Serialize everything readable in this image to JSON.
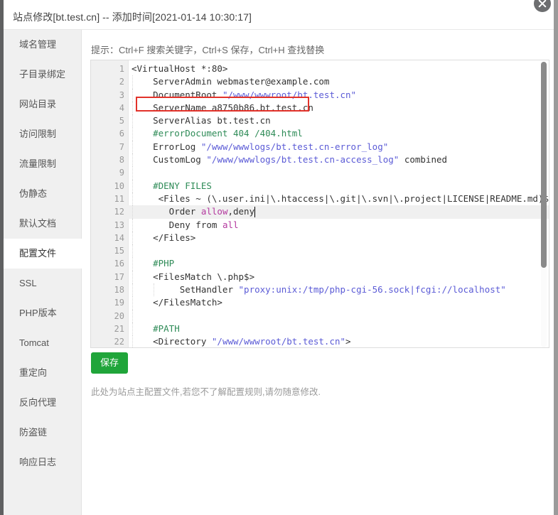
{
  "window": {
    "title": "站点修改[bt.test.cn] -- 添加时间[2021-01-14 10:30:17]",
    "close_label": "×"
  },
  "sidebar": {
    "items": [
      {
        "label": "域名管理",
        "active": false
      },
      {
        "label": "子目录绑定",
        "active": false
      },
      {
        "label": "网站目录",
        "active": false
      },
      {
        "label": "访问限制",
        "active": false
      },
      {
        "label": "流量限制",
        "active": false
      },
      {
        "label": "伪静态",
        "active": false
      },
      {
        "label": "默认文档",
        "active": false
      },
      {
        "label": "配置文件",
        "active": true
      },
      {
        "label": "SSL",
        "active": false
      },
      {
        "label": "PHP版本",
        "active": false
      },
      {
        "label": "Tomcat",
        "active": false
      },
      {
        "label": "重定向",
        "active": false
      },
      {
        "label": "反向代理",
        "active": false
      },
      {
        "label": "防盗链",
        "active": false
      },
      {
        "label": "响应日志",
        "active": false
      }
    ]
  },
  "main": {
    "tip": "提示：Ctrl+F 搜索关键字，Ctrl+S 保存，Ctrl+H 查找替换",
    "save_label": "保存",
    "footnote": "此处为站点主配置文件,若您不了解配置规则,请勿随意修改.",
    "highlight_color": "#e2322a",
    "save_color": "#20a53a"
  },
  "editor": {
    "active_line": 12,
    "total_lines_visible": 22,
    "lines": [
      {
        "n": 1,
        "tokens": [
          {
            "t": "<VirtualHost *:80>",
            "c": "plain"
          }
        ]
      },
      {
        "n": 2,
        "tokens": [
          {
            "t": "    ServerAdmin webmaster@example.com",
            "c": "plain"
          }
        ]
      },
      {
        "n": 3,
        "tokens": [
          {
            "t": "    DocumentRoot ",
            "c": "plain"
          },
          {
            "t": "\"/www/wwwroot/bt.test.cn\"",
            "c": "str"
          }
        ]
      },
      {
        "n": 4,
        "tokens": [
          {
            "t": "    ServerName a8750b86.bt.test.cn",
            "c": "plain"
          }
        ]
      },
      {
        "n": 5,
        "tokens": [
          {
            "t": "    ServerAlias bt.test.cn",
            "c": "plain"
          }
        ]
      },
      {
        "n": 6,
        "tokens": [
          {
            "t": "    #errorDocument 404 /404.html",
            "c": "com"
          }
        ]
      },
      {
        "n": 7,
        "tokens": [
          {
            "t": "    ErrorLog ",
            "c": "plain"
          },
          {
            "t": "\"/www/wwwlogs/bt.test.cn-error_log\"",
            "c": "str"
          }
        ]
      },
      {
        "n": 8,
        "tokens": [
          {
            "t": "    CustomLog ",
            "c": "plain"
          },
          {
            "t": "\"/www/wwwlogs/bt.test.cn-access_log\"",
            "c": "str"
          },
          {
            "t": " combined",
            "c": "plain"
          }
        ]
      },
      {
        "n": 9,
        "tokens": [
          {
            "t": "",
            "c": "plain"
          }
        ]
      },
      {
        "n": 10,
        "tokens": [
          {
            "t": "    #DENY FILES",
            "c": "com"
          }
        ]
      },
      {
        "n": 11,
        "tokens": [
          {
            "t": "     <Files ~ (\\.user.ini|\\.htaccess|\\.git|\\.svn|\\.project|LICENSE|README.md)$>",
            "c": "plain"
          }
        ]
      },
      {
        "n": 12,
        "tokens": [
          {
            "t": "       Order ",
            "c": "plain"
          },
          {
            "t": "allow",
            "c": "val"
          },
          {
            "t": ",deny",
            "c": "plain"
          }
        ]
      },
      {
        "n": 13,
        "tokens": [
          {
            "t": "       Deny from ",
            "c": "plain"
          },
          {
            "t": "all",
            "c": "val"
          }
        ]
      },
      {
        "n": 14,
        "tokens": [
          {
            "t": "    </Files>",
            "c": "plain"
          }
        ]
      },
      {
        "n": 15,
        "tokens": [
          {
            "t": "",
            "c": "plain"
          }
        ]
      },
      {
        "n": 16,
        "tokens": [
          {
            "t": "    #PHP",
            "c": "com"
          }
        ]
      },
      {
        "n": 17,
        "tokens": [
          {
            "t": "    <FilesMatch \\.php$>",
            "c": "plain"
          }
        ]
      },
      {
        "n": 18,
        "tokens": [
          {
            "t": "         SetHandler ",
            "c": "plain"
          },
          {
            "t": "\"proxy:unix:/tmp/php-cgi-56.sock|fcgi://localhost\"",
            "c": "str"
          }
        ]
      },
      {
        "n": 19,
        "tokens": [
          {
            "t": "    </FilesMatch>",
            "c": "plain"
          }
        ]
      },
      {
        "n": 20,
        "tokens": [
          {
            "t": "",
            "c": "plain"
          }
        ]
      },
      {
        "n": 21,
        "tokens": [
          {
            "t": "    #PATH",
            "c": "com"
          }
        ]
      },
      {
        "n": 22,
        "tokens": [
          {
            "t": "    <Directory ",
            "c": "plain"
          },
          {
            "t": "\"/www/wwwroot/bt.test.cn\"",
            "c": "str"
          },
          {
            "t": ">",
            "c": "plain"
          }
        ]
      }
    ]
  }
}
